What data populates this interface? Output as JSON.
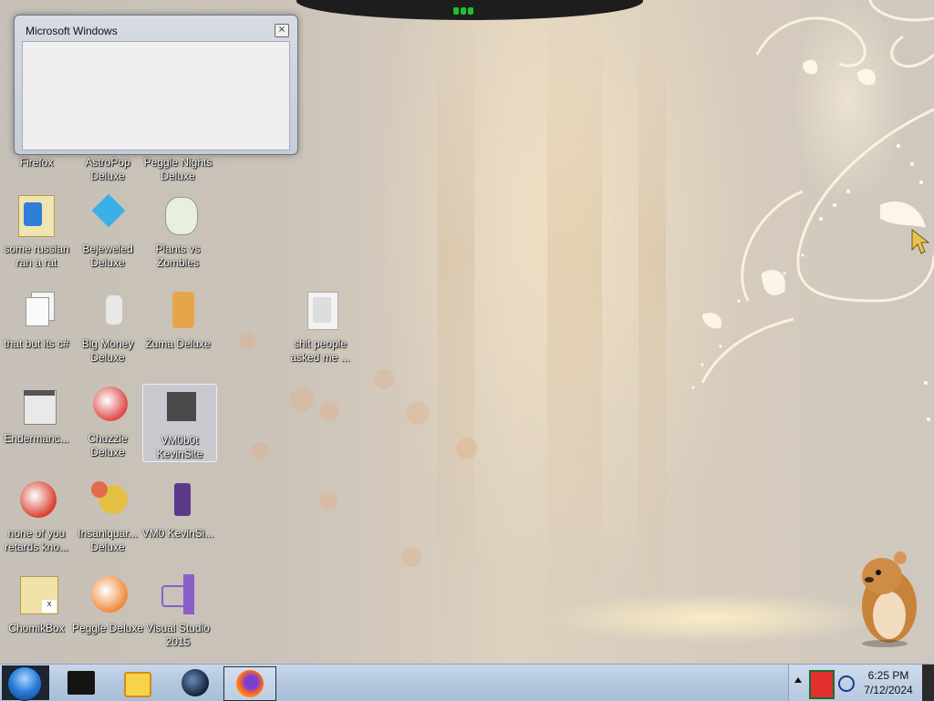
{
  "dialog": {
    "title": "Microsoft Windows",
    "close_label": "×"
  },
  "desktop_icons": [
    {
      "label": "Firefox",
      "icon": "firefox-icon"
    },
    {
      "label": "AstroPop Deluxe",
      "icon": "astropop-icon"
    },
    {
      "label": "Peggle Nights Deluxe",
      "icon": "peggle-nights-icon"
    },
    {
      "label": "some russian ran a rat",
      "icon": "ie-file-icon"
    },
    {
      "label": "Bejeweled Deluxe",
      "icon": "bejeweled-icon"
    },
    {
      "label": "Plants vs Zombies",
      "icon": "plants-vs-zombies-icon"
    },
    {
      "label": "that but its c#",
      "icon": "copy-pages-icon"
    },
    {
      "label": "Big Money Deluxe",
      "icon": "big-money-icon"
    },
    {
      "label": "Zuma Deluxe",
      "icon": "zuma-icon"
    },
    {
      "label": "shit people asked me ...",
      "icon": "folder-icon"
    },
    {
      "label": "Endermanc...",
      "icon": "window-app-icon"
    },
    {
      "label": "Chuzzle Deluxe",
      "icon": "chuzzle-icon"
    },
    {
      "label": "VM0b0t KevinSite",
      "icon": "dark-app-icon"
    },
    {
      "label": "none of you retards kno...",
      "icon": "peggle-ball-icon"
    },
    {
      "label": "Insaniquar... Deluxe",
      "icon": "insaniquarium-icon"
    },
    {
      "label": "VM0 KevinSi...",
      "icon": "vm-script-icon"
    },
    {
      "label": "ChomikBox",
      "icon": "chomikbox-icon"
    },
    {
      "label": "Peggle Deluxe",
      "icon": "peggle-icon"
    },
    {
      "label": "Visual Studio 2015",
      "icon": "visual-studio-icon"
    }
  ],
  "taskbar": {
    "start_label": "Start",
    "pinned": [
      {
        "name": "terminal-app-icon"
      },
      {
        "name": "media-player-icon"
      },
      {
        "name": "globe-app-icon"
      },
      {
        "name": "firefox-taskbar-icon"
      }
    ],
    "clock_time": "6:25 PM",
    "clock_date": "7/12/2024"
  },
  "colors": {
    "taskbar": "#b3c7df",
    "start_orb": "#2b7dd6",
    "dialog_body": "#efefef"
  }
}
